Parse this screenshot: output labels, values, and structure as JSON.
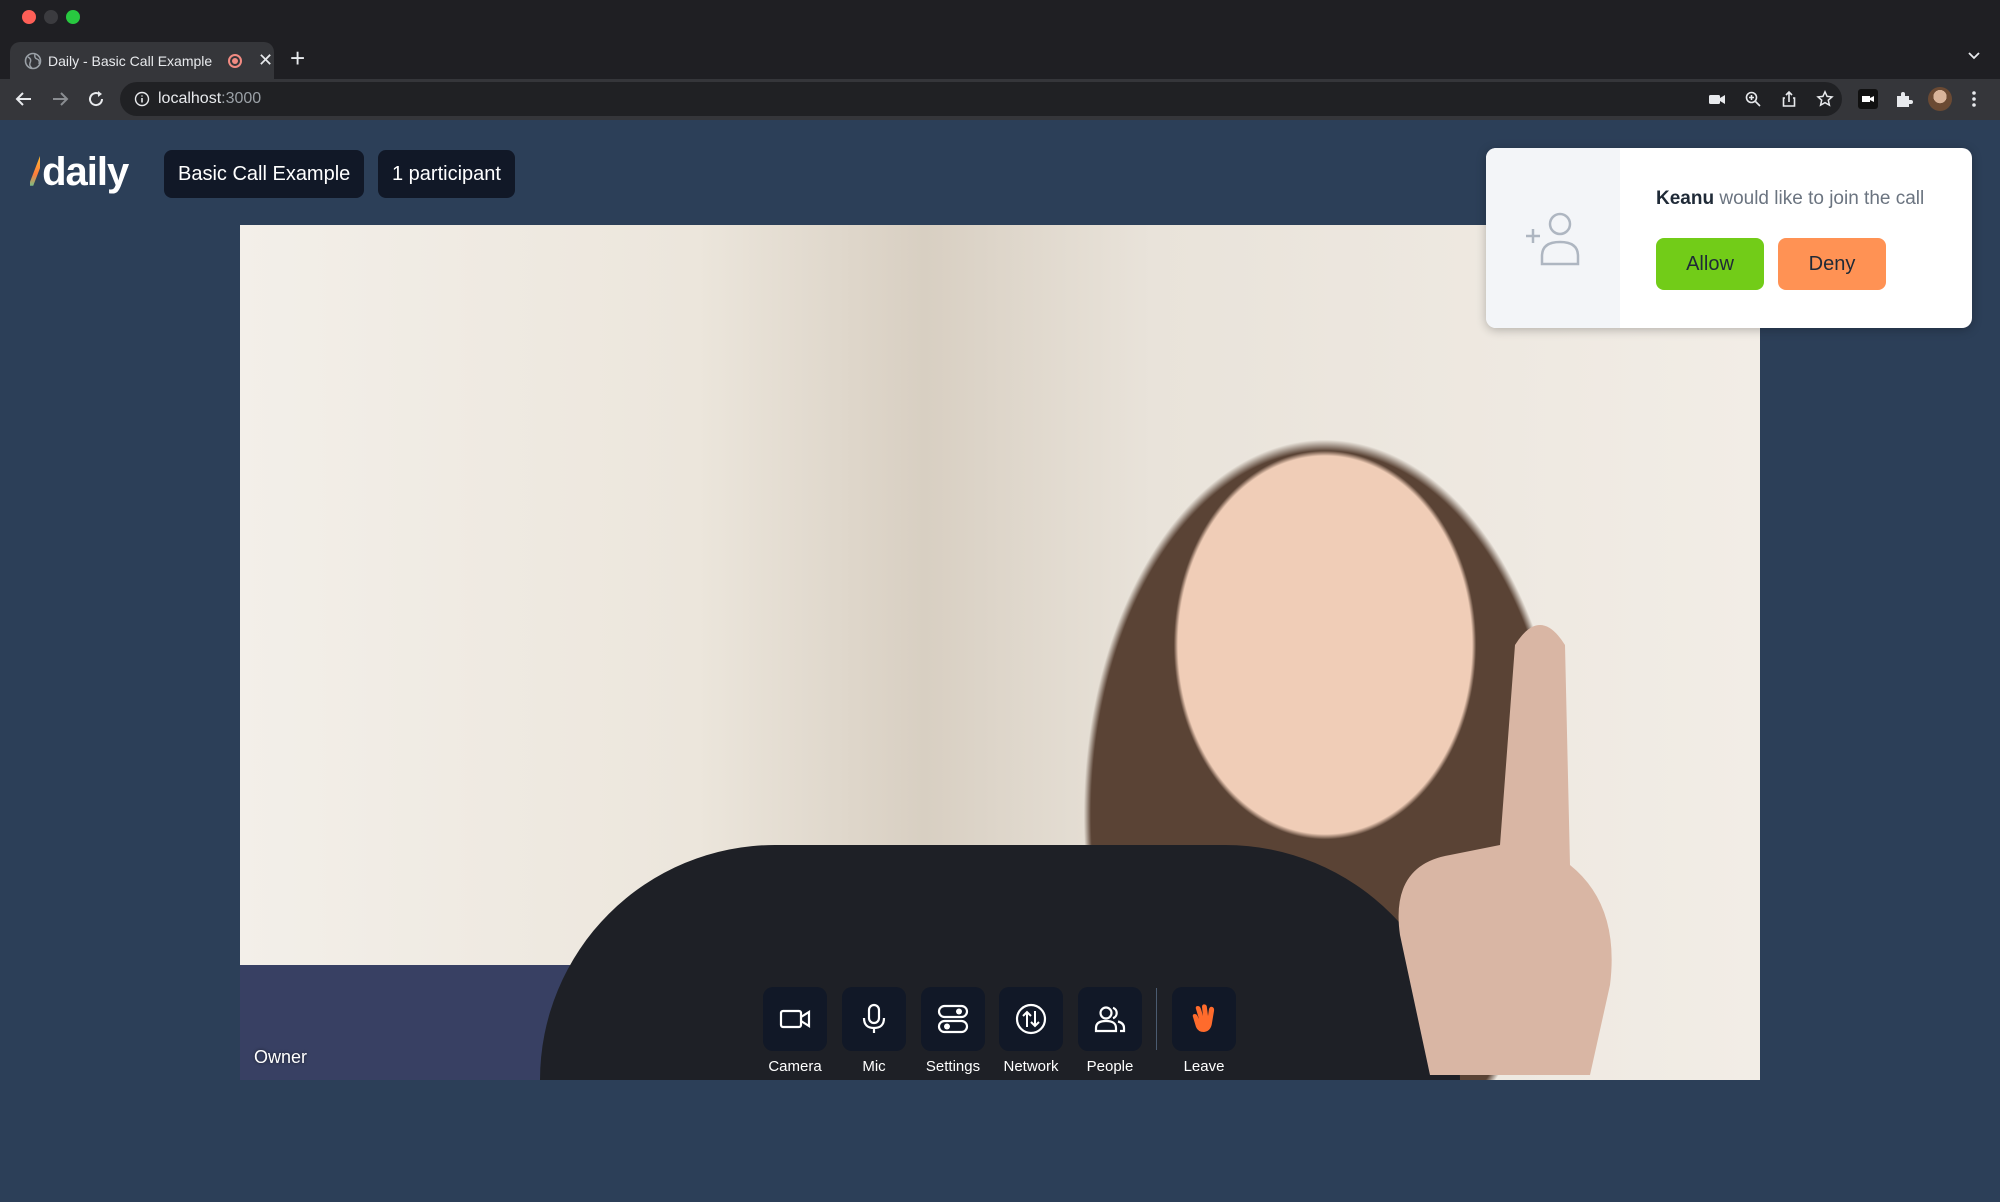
{
  "browser": {
    "tab_title": "Daily - Basic Call Example",
    "url_host": "localhost",
    "url_port": ":3000"
  },
  "app": {
    "logo_text": "daily",
    "room_name": "Basic Call Example",
    "participant_count": "1 participant",
    "video_label": "Owner"
  },
  "notification": {
    "requester_name": "Keanu",
    "message": " would like to join the call",
    "allow_label": "Allow",
    "deny_label": "Deny"
  },
  "tray": {
    "camera": "Camera",
    "mic": "Mic",
    "settings": "Settings",
    "network": "Network",
    "people": "People",
    "leave": "Leave"
  },
  "colors": {
    "background": "#2c3f58",
    "pill": "#111827",
    "allow": "#72cc18",
    "deny": "#ff9254",
    "leave_icon": "#ff6b2c"
  }
}
